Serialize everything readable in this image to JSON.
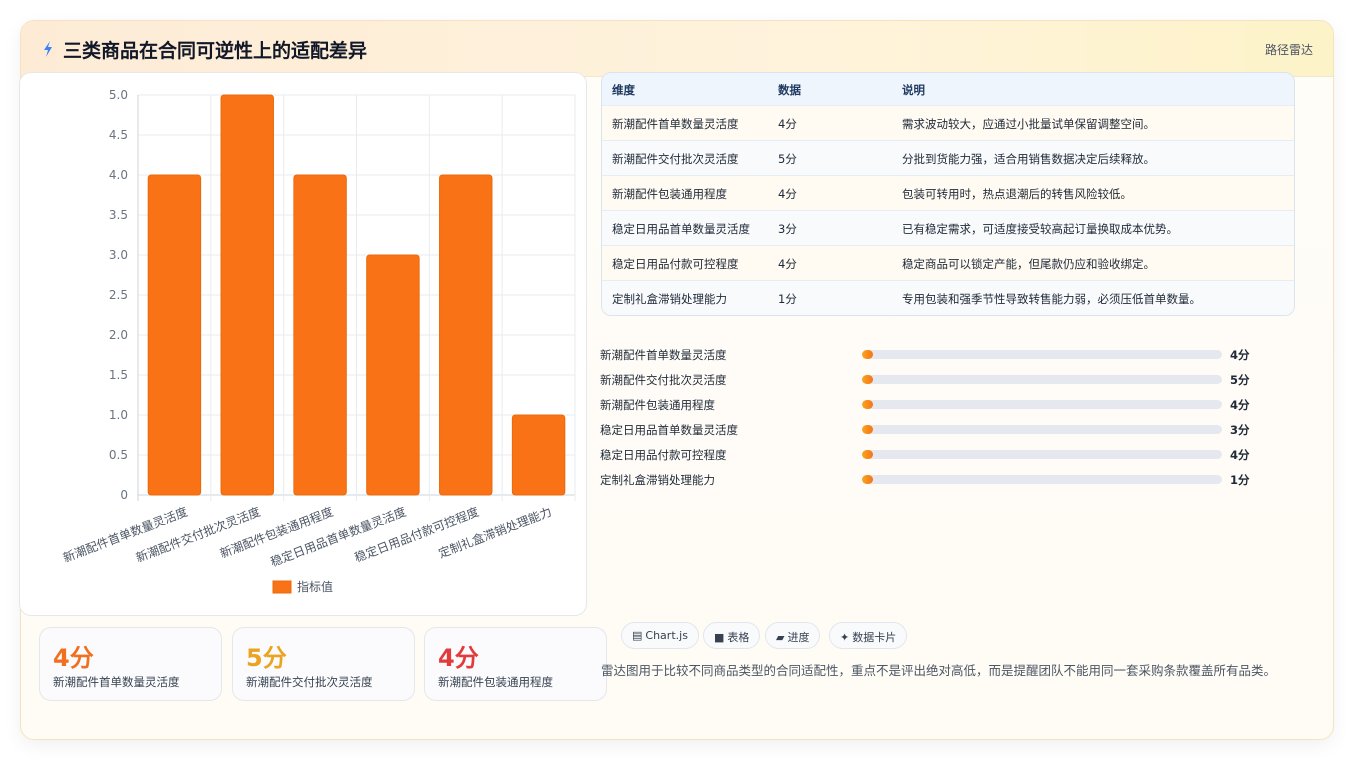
{
  "header": {
    "title": "三类商品在合同可逆性上的适配差异",
    "tag": "路径雷达",
    "icon": "lightning-icon"
  },
  "colors": {
    "bar": "#f97316",
    "bar_border": "#ea6a0c",
    "accent_orange": "#f07020",
    "accent_amber": "#eba421",
    "accent_red": "#e23b3b"
  },
  "chart_data": {
    "type": "bar",
    "categories": [
      "新潮配件首单数量灵活度",
      "新潮配件交付批次灵活度",
      "新潮配件包装通用程度",
      "稳定日用品首单数量灵活度",
      "稳定日用品付款可控程度",
      "定制礼盒滞销处理能力"
    ],
    "series": [
      {
        "name": "指标值",
        "values": [
          4,
          5,
          4,
          3,
          4,
          1
        ]
      }
    ],
    "ylim": [
      0,
      5
    ],
    "yticks": [
      "0",
      "0.5",
      "1.0",
      "1.5",
      "2.0",
      "2.5",
      "3.0",
      "3.5",
      "4.0",
      "4.5",
      "5.0"
    ],
    "grid": true,
    "legend": "bottom"
  },
  "stats": [
    {
      "value": "4分",
      "label": "新潮配件首单数量灵活度"
    },
    {
      "value": "5分",
      "label": "新潮配件交付批次灵活度"
    },
    {
      "value": "4分",
      "label": "新潮配件包装通用程度"
    }
  ],
  "table": {
    "headers": [
      "维度",
      "数据",
      "说明"
    ],
    "rows": [
      [
        "新潮配件首单数量灵活度",
        "4分",
        "需求波动较大，应通过小批量试单保留调整空间。"
      ],
      [
        "新潮配件交付批次灵活度",
        "5分",
        "分批到货能力强，适合用销售数据决定后续释放。"
      ],
      [
        "新潮配件包装通用程度",
        "4分",
        "包装可转用时，热点退潮后的转售风险较低。"
      ],
      [
        "稳定日用品首单数量灵活度",
        "3分",
        "已有稳定需求，可适度接受较高起订量换取成本优势。"
      ],
      [
        "稳定日用品付款可控程度",
        "4分",
        "稳定商品可以锁定产能，但尾款仍应和验收绑定。"
      ],
      [
        "定制礼盒滞销处理能力",
        "1分",
        "专用包装和强季节性导致转售能力弱，必须压低首单数量。"
      ]
    ]
  },
  "progress": [
    {
      "label": "新潮配件首单数量灵活度",
      "value": "4分",
      "fraction": 0.02
    },
    {
      "label": "新潮配件交付批次灵活度",
      "value": "5分",
      "fraction": 0.02
    },
    {
      "label": "新潮配件包装通用程度",
      "value": "4分",
      "fraction": 0.02
    },
    {
      "label": "稳定日用品首单数量灵活度",
      "value": "3分",
      "fraction": 0.02
    },
    {
      "label": "稳定日用品付款可控程度",
      "value": "4分",
      "fraction": 0.02
    },
    {
      "label": "定制礼盒滞销处理能力",
      "value": "1分",
      "fraction": 0.02
    }
  ],
  "chips": [
    {
      "icon": "chart-icon",
      "glyph": "▤",
      "label": "Chart.js"
    },
    {
      "icon": "table-icon",
      "glyph": "■",
      "label": "表格"
    },
    {
      "icon": "progress-icon",
      "glyph": "▰",
      "label": "进度"
    },
    {
      "icon": "sparkle-icon",
      "glyph": "✦",
      "label": "数据卡片"
    }
  ],
  "note": "雷达图用于比较不同商品类型的合同适配性，重点不是评出绝对高低，而是提醒团队不能用同一套采购条款覆盖所有品类。"
}
